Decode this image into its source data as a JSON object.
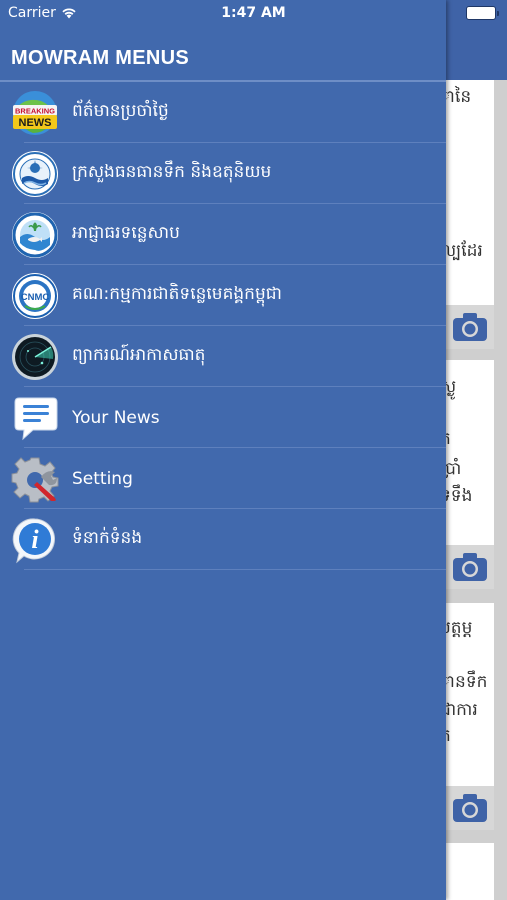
{
  "status_bar": {
    "carrier": "Carrier",
    "time": "1:47 AM"
  },
  "drawer": {
    "title": "MOWRAM MENUS",
    "items": [
      {
        "label": "ព័ត៌មានប្រចាំថ្ងៃ",
        "icon": "breaking-news-icon",
        "icon_text": "BREAKING NEWS"
      },
      {
        "label": "ក្រសួងធនធានទឹក និងឧតុនិយម",
        "icon": "ministry-logo-icon"
      },
      {
        "label": "អាជ្ញាធរទន្លេសាប",
        "icon": "tonle-sap-authority-logo-icon"
      },
      {
        "label": "គណ:កម្មការជាតិទន្លេមេគង្គកម្ពុជា",
        "icon": "cnmc-logo-icon",
        "icon_text": "CNMC"
      },
      {
        "label": "ព្យាករណ៍អាកាសធាតុ",
        "icon": "weather-radar-icon"
      },
      {
        "label": "Your News",
        "icon": "speech-bubble-icon"
      },
      {
        "label": "Setting",
        "icon": "settings-gear-icon"
      },
      {
        "label": "ទំនាក់ទំនង",
        "icon": "info-icon",
        "icon_text": "i"
      }
    ]
  },
  "background_cards": [
    {
      "lines": [
        "ានៃ",
        "",
        "",
        "",
        "ល្បដែរ"
      ]
    },
    {
      "lines": [
        "ស្ងូ",
        "",
        "ក",
        "ប្រាំ",
        "ទទឹង"
      ]
    },
    {
      "lines": [
        "បត្តម្ត",
        "",
        "ានទឹក",
        "ជាការ",
        "ក"
      ]
    }
  ],
  "colors": {
    "drawer_bg": "#4169ad",
    "nav_bar": "#3f63a7",
    "card_bg": "#ffffff",
    "camera": "#3f63a7"
  }
}
